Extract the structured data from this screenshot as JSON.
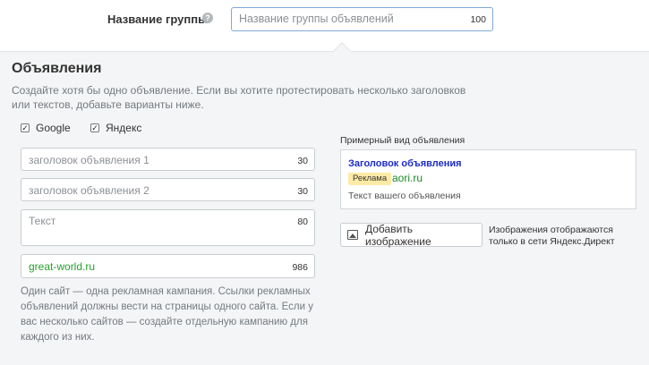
{
  "group": {
    "label": "Название группы",
    "placeholder": "Название группы объявлений",
    "counter": "100"
  },
  "ads_section": {
    "title": "Объявления",
    "description": "Создайте хотя бы одно объявление. Если вы хотите протестировать несколько заголовков или текстов, добавьте варианты ниже."
  },
  "networks": [
    {
      "label": "Google",
      "checked": true
    },
    {
      "label": "Яндекс",
      "checked": true
    }
  ],
  "fields": {
    "headline1": {
      "placeholder": "заголовок объявления 1",
      "counter": "30"
    },
    "headline2": {
      "placeholder": "заголовок объявления 2",
      "counter": "30"
    },
    "text": {
      "placeholder": "Текст",
      "counter": "80"
    },
    "site": {
      "value": "great-world.ru",
      "counter": "986"
    }
  },
  "site_note": "Один сайт — одна рекламная кампания. Ссылки рекламных объявлений должны вести на страницы одного сайта. Если у вас несколько сайтов — создайте отдельную кампанию для каждого из них.",
  "preview": {
    "caption": "Примерный вид объявления",
    "title": "Заголовок объявления",
    "badge": "Реклама",
    "domain": "aori.ru",
    "text": "Текст вашего объявления"
  },
  "image": {
    "button_label": "Добавить изображение",
    "note": "Изображения отображаются только в сети Яндекс.Директ",
    "icon": "image-icon"
  },
  "colors": {
    "link_blue": "#1c2ccb",
    "domain_green": "#1c8a23",
    "site_green": "#27a02e",
    "badge_yellow": "#fdeaa5",
    "focus_border": "#7ea9d6"
  }
}
